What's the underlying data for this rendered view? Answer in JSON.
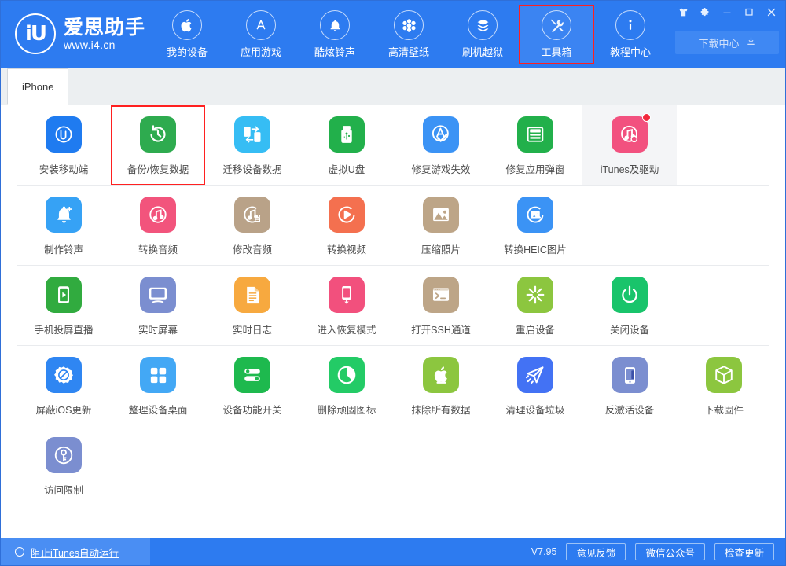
{
  "header": {
    "logo": {
      "mark": "iU",
      "brand": "爱思助手",
      "url": "www.i4.cn"
    },
    "nav": [
      {
        "label": "我的设备",
        "icon": "apple-icon",
        "active": false,
        "outlined": false
      },
      {
        "label": "应用游戏",
        "icon": "appstore-icon",
        "active": false,
        "outlined": false
      },
      {
        "label": "酷炫铃声",
        "icon": "bell-icon",
        "active": false,
        "outlined": false
      },
      {
        "label": "高清壁纸",
        "icon": "flower-icon",
        "active": false,
        "outlined": false
      },
      {
        "label": "刷机越狱",
        "icon": "box-icon",
        "active": false,
        "outlined": false
      },
      {
        "label": "工具箱",
        "icon": "tools-icon",
        "active": true,
        "outlined": true
      },
      {
        "label": "教程中心",
        "icon": "info-icon",
        "active": false,
        "outlined": false
      }
    ],
    "window_buttons": [
      {
        "name": "skin-icon",
        "glyph": "skin"
      },
      {
        "name": "settings-gear-icon",
        "glyph": "gear"
      },
      {
        "name": "minimize-icon",
        "glyph": "minimize"
      },
      {
        "name": "maximize-icon",
        "glyph": "maximize"
      },
      {
        "name": "close-icon",
        "glyph": "close"
      }
    ],
    "download_center": {
      "label": "下载中心",
      "icon": "download-icon"
    }
  },
  "tabs": [
    {
      "label": "iPhone",
      "active": true
    }
  ],
  "grid": {
    "rows": [
      {
        "separator": true,
        "cells": [
          {
            "label": "安装移动端",
            "icon": "i4-app-icon",
            "bg": "#1f7bf0",
            "state": "normal"
          },
          {
            "label": "备份/恢复数据",
            "icon": "backup-restore-icon",
            "bg": "#2eab4f",
            "state": "outlined"
          },
          {
            "label": "迁移设备数据",
            "icon": "migrate-data-icon",
            "bg": "#36bdf4",
            "state": "normal"
          },
          {
            "label": "虚拟U盘",
            "icon": "usb-drive-icon",
            "bg": "#22b04b",
            "state": "normal"
          },
          {
            "label": "修复游戏失效",
            "icon": "fix-game-icon",
            "bg": "#3b93f5",
            "state": "normal"
          },
          {
            "label": "修复应用弹窗",
            "icon": "appleid-popup-icon",
            "bg": "#22b04b",
            "state": "normal"
          },
          {
            "label": "iTunes及驱动",
            "icon": "itunes-driver-icon",
            "bg": "#f2517f",
            "state": "highlight",
            "badge": true
          }
        ]
      },
      {
        "separator": true,
        "cells": [
          {
            "label": "制作铃声",
            "icon": "make-ringtone-icon",
            "bg": "#36a2f5",
            "state": "normal"
          },
          {
            "label": "转换音频",
            "icon": "convert-audio-icon",
            "bg": "#f2547c",
            "state": "normal"
          },
          {
            "label": "修改音频",
            "icon": "edit-audio-icon",
            "bg": "#b9a288",
            "state": "normal"
          },
          {
            "label": "转换视频",
            "icon": "convert-video-icon",
            "bg": "#f4704f",
            "state": "normal"
          },
          {
            "label": "压缩照片",
            "icon": "compress-photo-icon",
            "bg": "#bda587",
            "state": "normal"
          },
          {
            "label": "转换HEIC图片",
            "icon": "convert-heic-icon",
            "bg": "#3b93f5",
            "state": "normal"
          }
        ]
      },
      {
        "separator": true,
        "cells": [
          {
            "label": "手机投屏直播",
            "icon": "screen-cast-icon",
            "bg": "#31ab3f",
            "state": "normal"
          },
          {
            "label": "实时屏幕",
            "icon": "live-screen-icon",
            "bg": "#7b8ed0",
            "state": "normal"
          },
          {
            "label": "实时日志",
            "icon": "live-log-icon",
            "bg": "#f7a93f",
            "state": "normal"
          },
          {
            "label": "进入恢复模式",
            "icon": "recovery-mode-icon",
            "bg": "#f2507d",
            "state": "normal"
          },
          {
            "label": "打开SSH通道",
            "icon": "ssh-tunnel-icon",
            "bg": "#bda587",
            "state": "normal"
          },
          {
            "label": "重启设备",
            "icon": "reboot-device-icon",
            "bg": "#8cc63f",
            "state": "normal"
          },
          {
            "label": "关闭设备",
            "icon": "shutdown-device-icon",
            "bg": "#19c46b",
            "state": "normal"
          }
        ]
      },
      {
        "separator": false,
        "cells": [
          {
            "label": "屏蔽iOS更新",
            "icon": "block-ios-update-icon",
            "bg": "#2f86f2",
            "state": "normal"
          },
          {
            "label": "整理设备桌面",
            "icon": "organize-desktop-icon",
            "bg": "#43a8f5",
            "state": "normal"
          },
          {
            "label": "设备功能开关",
            "icon": "feature-toggle-icon",
            "bg": "#1eb94e",
            "state": "normal"
          },
          {
            "label": "删除顽固图标",
            "icon": "remove-icon-icon",
            "bg": "#23cb66",
            "state": "normal"
          },
          {
            "label": "抹除所有数据",
            "icon": "erase-all-icon",
            "bg": "#8cc63f",
            "state": "normal"
          },
          {
            "label": "清理设备垃圾",
            "icon": "clean-junk-icon",
            "bg": "#4372f4",
            "state": "normal"
          },
          {
            "label": "反激活设备",
            "icon": "deactivate-device-icon",
            "bg": "#7b8ed0",
            "state": "normal"
          },
          {
            "label": "下载固件",
            "icon": "download-firmware-icon",
            "bg": "#8cc63f",
            "state": "normal"
          }
        ]
      },
      {
        "separator": false,
        "cells": [
          {
            "label": "访问限制",
            "icon": "access-restriction-icon",
            "bg": "#7b8ed0",
            "state": "normal"
          }
        ]
      }
    ]
  },
  "footer": {
    "block_itunes_label": "阻止iTunes自动运行",
    "version": "V7.95",
    "buttons": [
      {
        "label": "意见反馈"
      },
      {
        "label": "微信公众号"
      },
      {
        "label": "检查更新"
      }
    ]
  }
}
